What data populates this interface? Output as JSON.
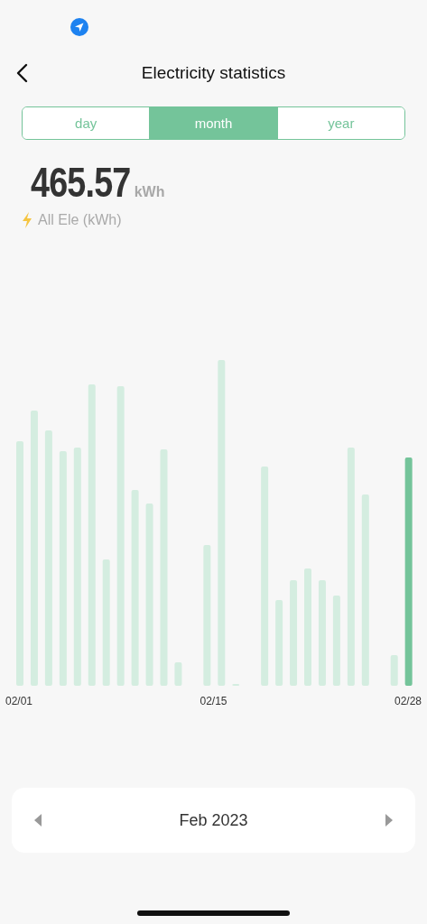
{
  "header": {
    "title": "Electricity statistics"
  },
  "tabs": [
    {
      "label": "day",
      "selected": false
    },
    {
      "label": "month",
      "selected": true
    },
    {
      "label": "year",
      "selected": false
    }
  ],
  "total": {
    "value": "465.57",
    "unit": "kWh",
    "caption": "All Ele (kWh)"
  },
  "chart": {
    "x_labels": [
      "02/01",
      "02/15",
      "02/28"
    ]
  },
  "period": {
    "label": "Feb 2023"
  }
}
